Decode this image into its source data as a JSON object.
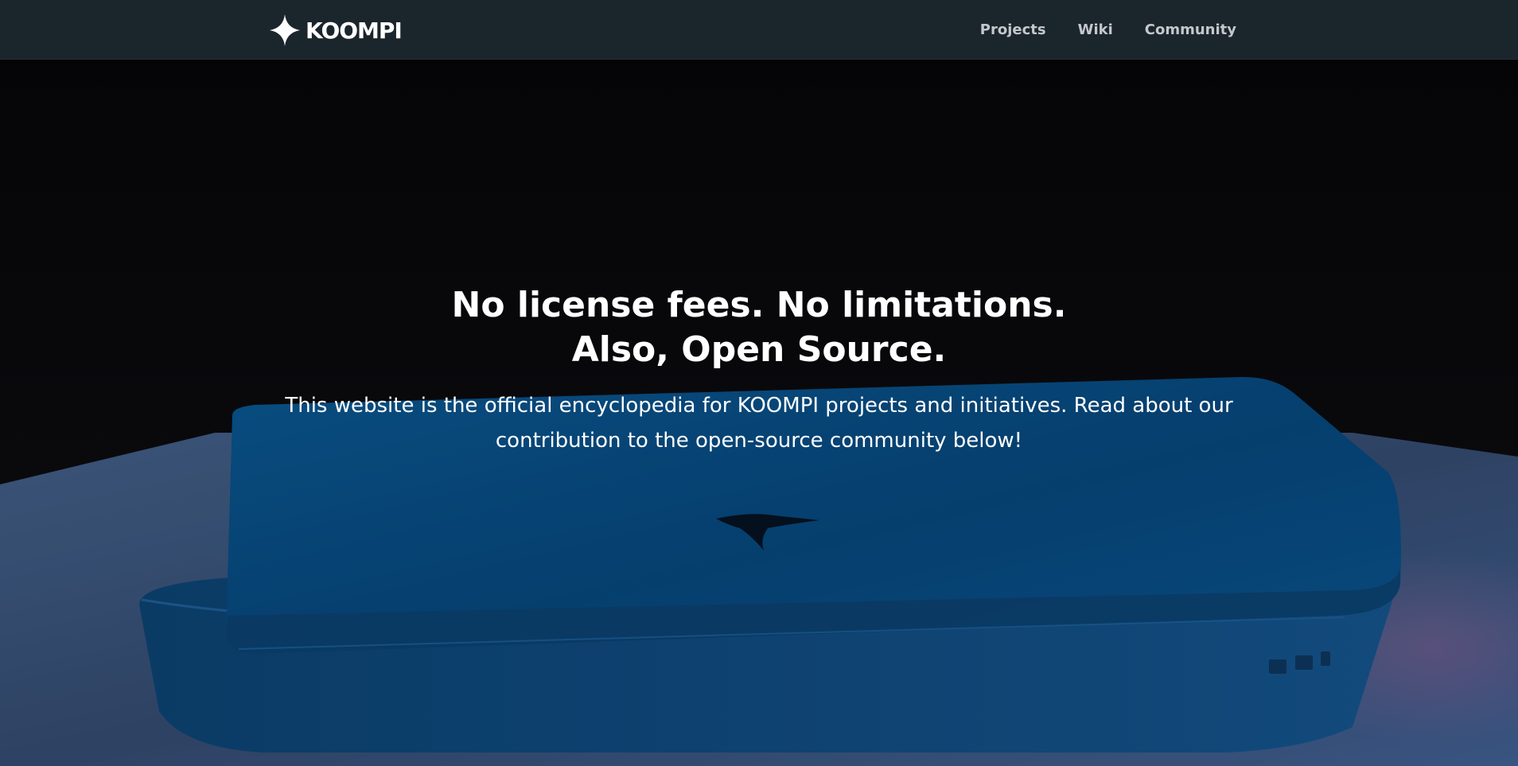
{
  "navbar": {
    "brand": {
      "logo_icon": "koompi-star-icon",
      "name": "KOOMPI"
    },
    "links": [
      {
        "label": "Projects"
      },
      {
        "label": "Wiki"
      },
      {
        "label": "Community"
      }
    ]
  },
  "hero": {
    "background": "laptop-photo",
    "title_lines": [
      "No license fees. No limitations.",
      "Also, Open Source."
    ],
    "subtitle_lines": [
      "This website is the official encyclopedia for KOOMPI projects and initiatives. Read about our",
      "contribution to the open-source community below!"
    ]
  },
  "colors": {
    "navbar_bg": "#1b252c",
    "nav_link": "#c4c8cc",
    "laptop_blue": "#0b4c7e",
    "text": "#ffffff"
  }
}
